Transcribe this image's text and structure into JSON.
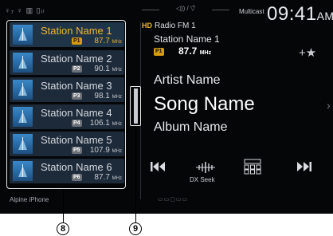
{
  "status": {
    "icons": "♀₇ ♀ ▥ ▯ᵢₗ",
    "volume_indicator": "◁)) / ▽̂",
    "multicast": "Multicast",
    "clock": "09:41",
    "clock_suffix": "AM"
  },
  "presets": [
    {
      "name": "Station Name 1",
      "badge": "P1",
      "freq": "87.7",
      "unit": "MHz",
      "active": true
    },
    {
      "name": "Station Name 2",
      "badge": "P2",
      "freq": "90.1",
      "unit": "MHz",
      "active": false
    },
    {
      "name": "Station Name 3",
      "badge": "P3",
      "freq": "98.1",
      "unit": "MHz",
      "active": false
    },
    {
      "name": "Station Name 4",
      "badge": "P4",
      "freq": "106.1",
      "unit": "MHz",
      "active": false
    },
    {
      "name": "Station Name 5",
      "badge": "P5",
      "freq": "107.9",
      "unit": "MHz",
      "active": false
    },
    {
      "name": "Station Name 6",
      "badge": "P6",
      "freq": "87.7",
      "unit": "MHz",
      "active": false
    }
  ],
  "now_playing": {
    "source_icon": "HD",
    "source": "Radio FM 1",
    "station": "Station Name 1",
    "badge": "P1",
    "freq": "87.7",
    "unit": "MHz",
    "favorite": "+★",
    "artist": "Artist Name",
    "song": "Song Name",
    "album": "Album Name"
  },
  "controls": {
    "dx_seek": "DX Seek"
  },
  "footer": {
    "device": "Alpine iPhone"
  },
  "callouts": {
    "list": "8",
    "scroll": "9"
  },
  "colors": {
    "accent": "#f0b430",
    "background": "#050608",
    "preset_bg": "#1d2a3a"
  }
}
